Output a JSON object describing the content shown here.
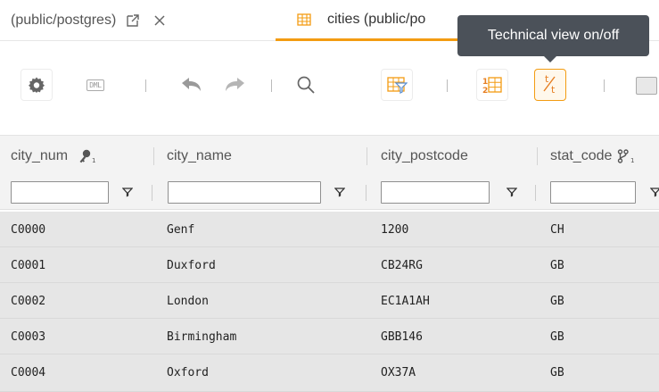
{
  "tabs": [
    {
      "label": "(public/postgres)"
    },
    {
      "label": "cities (public/po"
    }
  ],
  "tooltip": {
    "text": "Technical view on/off"
  },
  "toolbar": {
    "dml_label": "DML"
  },
  "grid": {
    "columns": [
      {
        "name": "city_num"
      },
      {
        "name": "city_name"
      },
      {
        "name": "city_postcode"
      },
      {
        "name": "stat_code"
      }
    ],
    "key_index": "1",
    "fk_index": "1",
    "rows": [
      [
        "C0000",
        "Genf",
        "1200",
        "CH"
      ],
      [
        "C0001",
        "Duxford",
        "CB24RG",
        "GB"
      ],
      [
        "C0002",
        "London",
        "EC1A1AH",
        "GB"
      ],
      [
        "C0003",
        "Birmingham",
        "GBB146",
        "GB"
      ],
      [
        "C0004",
        "Oxford",
        "OX37A",
        "GB"
      ]
    ]
  },
  "colors": {
    "accent": "#f39c12",
    "tooltip_bg": "#4b5159",
    "row_bg": "#e6e6e6"
  }
}
